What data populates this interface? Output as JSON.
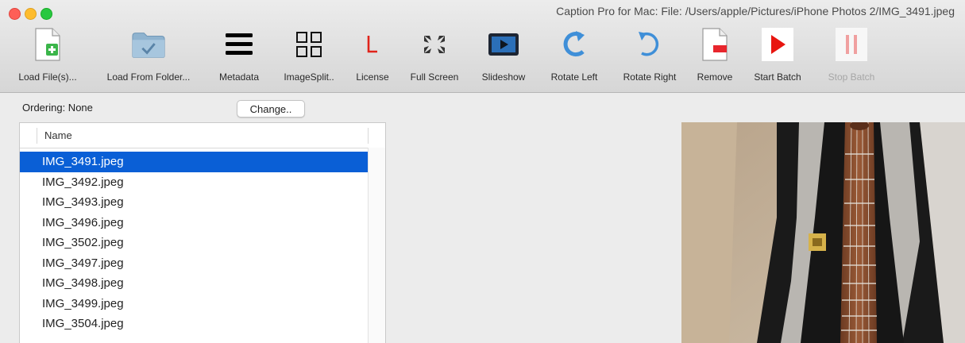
{
  "window": {
    "title": "Caption Pro for Mac: File: /Users/apple/Pictures/iPhone Photos 2/IMG_3491.jpeg"
  },
  "toolbar": {
    "buttons": [
      {
        "label": "Load File(s)...",
        "icon": "add-file-icon",
        "enabled": true
      },
      {
        "label": "Load From Folder...",
        "icon": "folder-icon",
        "enabled": true
      },
      {
        "label": "Metadata",
        "icon": "hamburger-icon",
        "enabled": true
      },
      {
        "label": "ImageSplit..",
        "icon": "grid-icon",
        "enabled": true
      },
      {
        "label": "License",
        "icon": "license-icon",
        "enabled": true
      },
      {
        "label": "Full Screen",
        "icon": "fullscreen-icon",
        "enabled": true
      },
      {
        "label": "Slideshow",
        "icon": "slideshow-icon",
        "enabled": true
      },
      {
        "label": "Rotate Left",
        "icon": "rotate-left-icon",
        "enabled": true
      },
      {
        "label": "Rotate Right",
        "icon": "rotate-right-icon",
        "enabled": true
      },
      {
        "label": "Remove",
        "icon": "remove-file-icon",
        "enabled": true
      },
      {
        "label": "Start Batch",
        "icon": "play-icon",
        "enabled": true
      },
      {
        "label": "Stop Batch",
        "icon": "pause-icon",
        "enabled": false
      }
    ]
  },
  "ordering": {
    "label": "Ordering: None",
    "change_button": "Change.."
  },
  "file_list": {
    "column_header": "Name",
    "selected_index": 0,
    "files": [
      "IMG_3491.jpeg",
      "IMG_3492.jpeg",
      "IMG_3493.jpeg",
      "IMG_3496.jpeg",
      "IMG_3502.jpeg",
      "IMG_3497.jpeg",
      "IMG_3498.jpeg",
      "IMG_3499.jpeg",
      "IMG_3504.jpeg"
    ]
  },
  "colors": {
    "selection": "#0a5fd6",
    "license_red": "#e0241b",
    "play_red": "#e8150f",
    "pause_disabled": "#f0a0a0",
    "folder_blue": "#8fb3cf",
    "rotate_blue": "#3f8fd8"
  }
}
